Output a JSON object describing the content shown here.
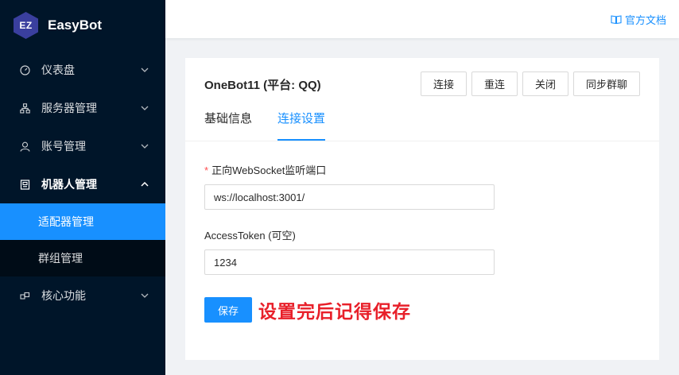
{
  "sidebar": {
    "logo_badge": "EZ",
    "app_name": "EasyBot",
    "items": [
      {
        "label": "仪表盘",
        "icon": "dashboard-icon"
      },
      {
        "label": "服务器管理",
        "icon": "cluster-icon"
      },
      {
        "label": "账号管理",
        "icon": "user-icon"
      },
      {
        "label": "机器人管理",
        "icon": "robot-icon"
      },
      {
        "label": "核心功能",
        "icon": "puzzle-icon"
      }
    ],
    "submenu": [
      {
        "label": "适配器管理"
      },
      {
        "label": "群组管理"
      }
    ]
  },
  "header": {
    "doc_link": "官方文档",
    "doc_icon": "book-icon"
  },
  "card": {
    "title": "OneBot11 (平台: QQ)",
    "buttons": [
      "连接",
      "重连",
      "关闭",
      "同步群聊"
    ],
    "tabs": [
      "基础信息",
      "连接设置"
    ],
    "active_tab": "连接设置"
  },
  "form": {
    "ws_label": "正向WebSocket监听端口",
    "ws_value": "ws://localhost:3001/",
    "token_label": "AccessToken (可空)",
    "token_value": "1234",
    "save_label": "保存"
  },
  "annotation": "设置完后记得保存",
  "colors": {
    "sidebar_bg": "#001529",
    "accent": "#1890ff",
    "annotation": "#e8202a"
  }
}
